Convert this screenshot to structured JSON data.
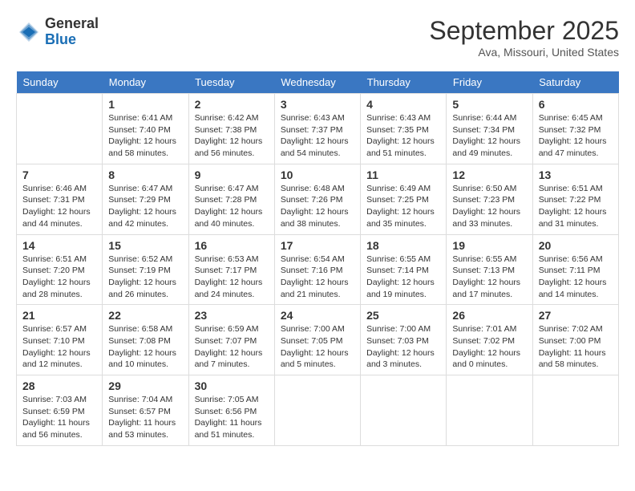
{
  "header": {
    "logo": {
      "general": "General",
      "blue": "Blue"
    },
    "title": "September 2025",
    "location": "Ava, Missouri, United States"
  },
  "weekdays": [
    "Sunday",
    "Monday",
    "Tuesday",
    "Wednesday",
    "Thursday",
    "Friday",
    "Saturday"
  ],
  "weeks": [
    [
      {
        "day": "",
        "sunrise": "",
        "sunset": "",
        "daylight": ""
      },
      {
        "day": "1",
        "sunrise": "Sunrise: 6:41 AM",
        "sunset": "Sunset: 7:40 PM",
        "daylight": "Daylight: 12 hours and 58 minutes."
      },
      {
        "day": "2",
        "sunrise": "Sunrise: 6:42 AM",
        "sunset": "Sunset: 7:38 PM",
        "daylight": "Daylight: 12 hours and 56 minutes."
      },
      {
        "day": "3",
        "sunrise": "Sunrise: 6:43 AM",
        "sunset": "Sunset: 7:37 PM",
        "daylight": "Daylight: 12 hours and 54 minutes."
      },
      {
        "day": "4",
        "sunrise": "Sunrise: 6:43 AM",
        "sunset": "Sunset: 7:35 PM",
        "daylight": "Daylight: 12 hours and 51 minutes."
      },
      {
        "day": "5",
        "sunrise": "Sunrise: 6:44 AM",
        "sunset": "Sunset: 7:34 PM",
        "daylight": "Daylight: 12 hours and 49 minutes."
      },
      {
        "day": "6",
        "sunrise": "Sunrise: 6:45 AM",
        "sunset": "Sunset: 7:32 PM",
        "daylight": "Daylight: 12 hours and 47 minutes."
      }
    ],
    [
      {
        "day": "7",
        "sunrise": "Sunrise: 6:46 AM",
        "sunset": "Sunset: 7:31 PM",
        "daylight": "Daylight: 12 hours and 44 minutes."
      },
      {
        "day": "8",
        "sunrise": "Sunrise: 6:47 AM",
        "sunset": "Sunset: 7:29 PM",
        "daylight": "Daylight: 12 hours and 42 minutes."
      },
      {
        "day": "9",
        "sunrise": "Sunrise: 6:47 AM",
        "sunset": "Sunset: 7:28 PM",
        "daylight": "Daylight: 12 hours and 40 minutes."
      },
      {
        "day": "10",
        "sunrise": "Sunrise: 6:48 AM",
        "sunset": "Sunset: 7:26 PM",
        "daylight": "Daylight: 12 hours and 38 minutes."
      },
      {
        "day": "11",
        "sunrise": "Sunrise: 6:49 AM",
        "sunset": "Sunset: 7:25 PM",
        "daylight": "Daylight: 12 hours and 35 minutes."
      },
      {
        "day": "12",
        "sunrise": "Sunrise: 6:50 AM",
        "sunset": "Sunset: 7:23 PM",
        "daylight": "Daylight: 12 hours and 33 minutes."
      },
      {
        "day": "13",
        "sunrise": "Sunrise: 6:51 AM",
        "sunset": "Sunset: 7:22 PM",
        "daylight": "Daylight: 12 hours and 31 minutes."
      }
    ],
    [
      {
        "day": "14",
        "sunrise": "Sunrise: 6:51 AM",
        "sunset": "Sunset: 7:20 PM",
        "daylight": "Daylight: 12 hours and 28 minutes."
      },
      {
        "day": "15",
        "sunrise": "Sunrise: 6:52 AM",
        "sunset": "Sunset: 7:19 PM",
        "daylight": "Daylight: 12 hours and 26 minutes."
      },
      {
        "day": "16",
        "sunrise": "Sunrise: 6:53 AM",
        "sunset": "Sunset: 7:17 PM",
        "daylight": "Daylight: 12 hours and 24 minutes."
      },
      {
        "day": "17",
        "sunrise": "Sunrise: 6:54 AM",
        "sunset": "Sunset: 7:16 PM",
        "daylight": "Daylight: 12 hours and 21 minutes."
      },
      {
        "day": "18",
        "sunrise": "Sunrise: 6:55 AM",
        "sunset": "Sunset: 7:14 PM",
        "daylight": "Daylight: 12 hours and 19 minutes."
      },
      {
        "day": "19",
        "sunrise": "Sunrise: 6:55 AM",
        "sunset": "Sunset: 7:13 PM",
        "daylight": "Daylight: 12 hours and 17 minutes."
      },
      {
        "day": "20",
        "sunrise": "Sunrise: 6:56 AM",
        "sunset": "Sunset: 7:11 PM",
        "daylight": "Daylight: 12 hours and 14 minutes."
      }
    ],
    [
      {
        "day": "21",
        "sunrise": "Sunrise: 6:57 AM",
        "sunset": "Sunset: 7:10 PM",
        "daylight": "Daylight: 12 hours and 12 minutes."
      },
      {
        "day": "22",
        "sunrise": "Sunrise: 6:58 AM",
        "sunset": "Sunset: 7:08 PM",
        "daylight": "Daylight: 12 hours and 10 minutes."
      },
      {
        "day": "23",
        "sunrise": "Sunrise: 6:59 AM",
        "sunset": "Sunset: 7:07 PM",
        "daylight": "Daylight: 12 hours and 7 minutes."
      },
      {
        "day": "24",
        "sunrise": "Sunrise: 7:00 AM",
        "sunset": "Sunset: 7:05 PM",
        "daylight": "Daylight: 12 hours and 5 minutes."
      },
      {
        "day": "25",
        "sunrise": "Sunrise: 7:00 AM",
        "sunset": "Sunset: 7:03 PM",
        "daylight": "Daylight: 12 hours and 3 minutes."
      },
      {
        "day": "26",
        "sunrise": "Sunrise: 7:01 AM",
        "sunset": "Sunset: 7:02 PM",
        "daylight": "Daylight: 12 hours and 0 minutes."
      },
      {
        "day": "27",
        "sunrise": "Sunrise: 7:02 AM",
        "sunset": "Sunset: 7:00 PM",
        "daylight": "Daylight: 11 hours and 58 minutes."
      }
    ],
    [
      {
        "day": "28",
        "sunrise": "Sunrise: 7:03 AM",
        "sunset": "Sunset: 6:59 PM",
        "daylight": "Daylight: 11 hours and 56 minutes."
      },
      {
        "day": "29",
        "sunrise": "Sunrise: 7:04 AM",
        "sunset": "Sunset: 6:57 PM",
        "daylight": "Daylight: 11 hours and 53 minutes."
      },
      {
        "day": "30",
        "sunrise": "Sunrise: 7:05 AM",
        "sunset": "Sunset: 6:56 PM",
        "daylight": "Daylight: 11 hours and 51 minutes."
      },
      {
        "day": "",
        "sunrise": "",
        "sunset": "",
        "daylight": ""
      },
      {
        "day": "",
        "sunrise": "",
        "sunset": "",
        "daylight": ""
      },
      {
        "day": "",
        "sunrise": "",
        "sunset": "",
        "daylight": ""
      },
      {
        "day": "",
        "sunrise": "",
        "sunset": "",
        "daylight": ""
      }
    ]
  ]
}
